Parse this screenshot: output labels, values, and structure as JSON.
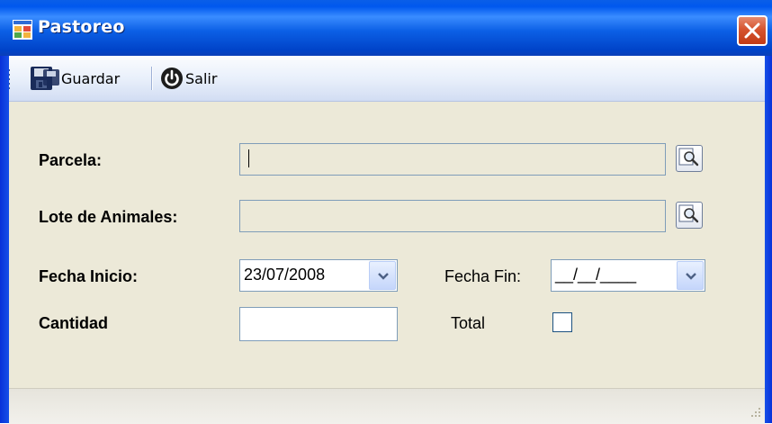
{
  "window": {
    "title": "Pastoreo",
    "close_icon": "close-icon"
  },
  "toolbar": {
    "save_label": "Guardar",
    "exit_label": "Salir"
  },
  "form": {
    "parcela_label": "Parcela:",
    "parcela_value": "",
    "lote_label": "Lote de Animales:",
    "lote_value": "",
    "fecha_inicio_label": "Fecha Inicio:",
    "fecha_inicio_value": "23/07/2008",
    "fecha_fin_label": "Fecha Fin:",
    "fecha_fin_value": "__/__/____",
    "cantidad_label": "Cantidad",
    "cantidad_value": "",
    "total_label": "Total",
    "total_checked": false
  },
  "colors": {
    "titlebar": "#0058EE",
    "window_bg": "#ECE9D8",
    "close": "#D6542F",
    "input_border": "#7F9DB9"
  }
}
